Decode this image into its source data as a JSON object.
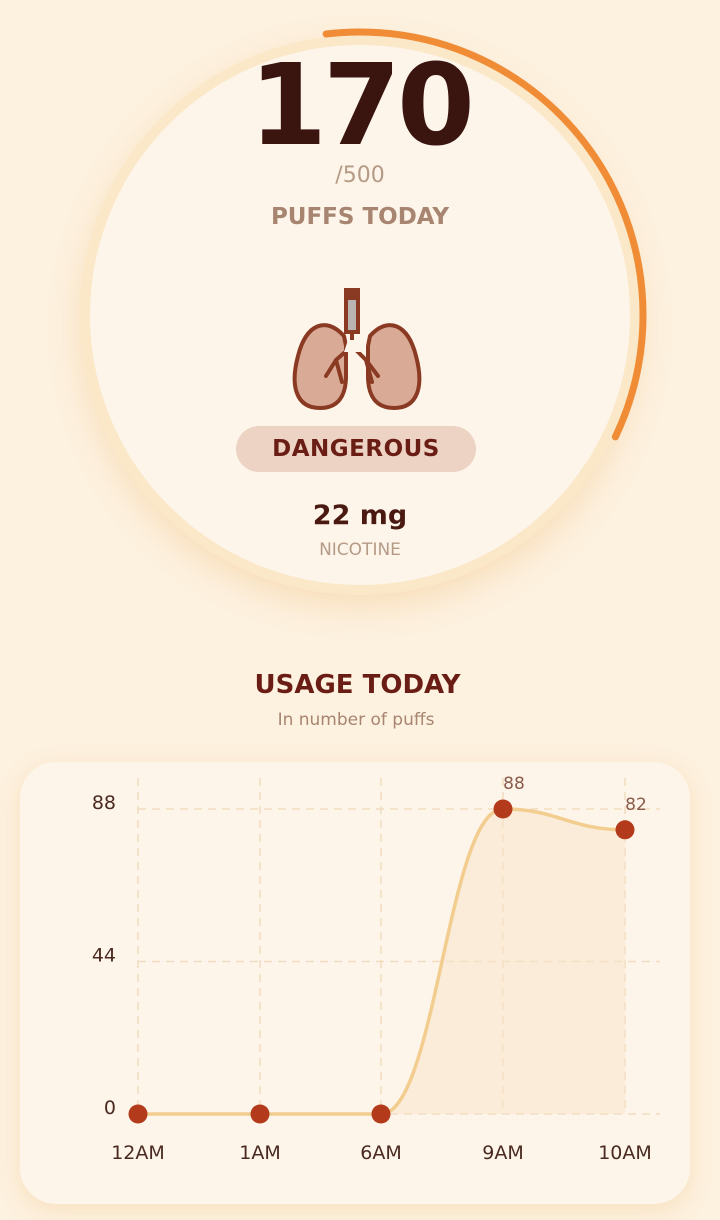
{
  "gauge": {
    "count": "170",
    "max": "/500",
    "label": "PUFFS TODAY",
    "progress_fraction": 0.34,
    "accent_color": "#ef8c35"
  },
  "status": {
    "level": "DANGEROUS",
    "icon": "lungs-icon"
  },
  "nicotine": {
    "value": "22 mg",
    "label": "NICOTINE"
  },
  "usage_section": {
    "title": "USAGE TODAY",
    "subtitle": "In number of puffs"
  },
  "chart_data": {
    "type": "line",
    "categories": [
      "12AM",
      "1AM",
      "6AM",
      "9AM",
      "10AM"
    ],
    "values": [
      0,
      0,
      0,
      88,
      82
    ],
    "yticks": [
      0,
      44,
      88
    ],
    "ylim": [
      0,
      88
    ],
    "data_labels": [
      "",
      "",
      "",
      "88",
      "82"
    ],
    "title": "",
    "xlabel": "",
    "ylabel": "",
    "grid": true,
    "line_color": "#f2cd8f",
    "point_color": "#b33a1b",
    "fill_color": "#f8e4c8"
  }
}
